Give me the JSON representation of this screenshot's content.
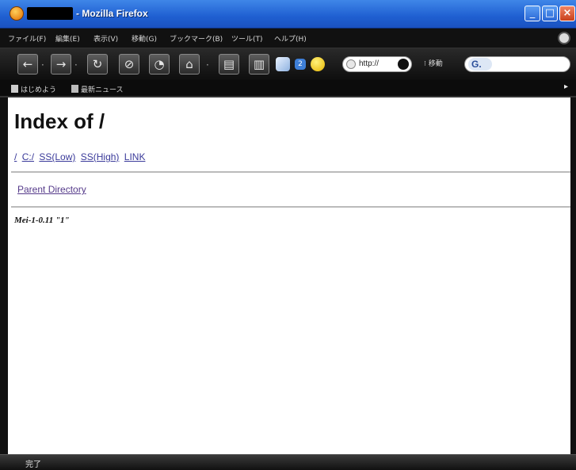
{
  "window": {
    "title": "- Mozilla Firefox",
    "controls": {
      "minimize": "_",
      "maximize": "□",
      "close": "×"
    }
  },
  "menu": {
    "items": [
      "ファイル(F)",
      "編集(E)",
      "表示(V)",
      "移動(G)",
      "ブックマーク(B)",
      "ツール(T)",
      "ヘルプ(H)"
    ]
  },
  "toolbar": {
    "back_glyph": "←",
    "forward_glyph": "→",
    "reload_glyph": "↻",
    "stop_glyph": "⊘",
    "history_glyph": "◔",
    "home_glyph": "⌂",
    "print_glyph": "▤",
    "trash_glyph": "▥",
    "badge_count": "2",
    "url_text": "http://",
    "go_label": "移動",
    "search_engine_label": "G."
  },
  "bookmarks": {
    "items": [
      "はじめよう",
      "最新ニュース"
    ],
    "overflow": "▸"
  },
  "page": {
    "title": "Index of /",
    "links": [
      "/",
      "C:/",
      "SS(Low)",
      "SS(High)",
      "LINK"
    ],
    "parent_directory": "Parent Directory",
    "server_signature": "Mei-1-0.11 \"1\""
  },
  "status": {
    "text": "完了"
  },
  "colors": {
    "titlebar": "#2a6ad8",
    "chrome_dark": "#111111",
    "link": "#3a3a9a",
    "visited_link": "#553a8a"
  }
}
